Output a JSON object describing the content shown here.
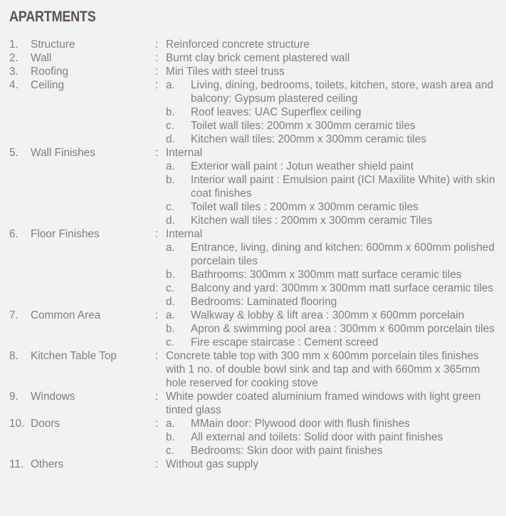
{
  "title": "APARTMENTS",
  "items": [
    {
      "num": "1.",
      "label": "Structure",
      "text": "Reinforced concrete structure",
      "subs": []
    },
    {
      "num": "2.",
      "label": "Wall",
      "text": "Burnt clay brick cement plastered wall",
      "subs": []
    },
    {
      "num": "3.",
      "label": "Roofing",
      "text": "Miri Tiles with steel truss",
      "subs": []
    },
    {
      "num": "4.",
      "label": "Ceiling",
      "text": "",
      "subs": [
        {
          "letter": "a.",
          "text": "Living, dining, bedrooms, toilets, kitchen, store, wash area and balcony: Gypsum plastered ceiling"
        },
        {
          "letter": "b.",
          "text": "Roof leaves: UAC Superflex ceiling"
        },
        {
          "letter": "c.",
          "text": "Toilet wall tiles: 200mm x 300mm ceramic tiles"
        },
        {
          "letter": "d.",
          "text": "Kitchen wall tiles: 200mm x 300mm ceramic tiles"
        }
      ]
    },
    {
      "num": "5.",
      "label": "Wall Finishes",
      "text": "Internal",
      "subs": [
        {
          "letter": "a.",
          "text": "Exterior wall paint : Jotun weather shield paint"
        },
        {
          "letter": "b.",
          "text": "Interior wall paint : Emulsion paint (ICI Maxilite White) with skin coat finishes"
        },
        {
          "letter": "c.",
          "text": "Toilet wall tiles : 200mm x 300mm ceramic tiles"
        },
        {
          "letter": "d.",
          "text": "Kitchen wall tiles : 200mm x 300mm ceramic Tiles"
        }
      ]
    },
    {
      "num": "6.",
      "label": "Floor Finishes",
      "text": "Internal",
      "subs": [
        {
          "letter": "a.",
          "text": "Entrance, living, dining and kitchen: 600mm x 600mm polished porcelain tiles"
        },
        {
          "letter": "b.",
          "text": "Bathrooms: 300mm x 300mm matt surface ceramic tiles"
        },
        {
          "letter": "c.",
          "text": "Balcony and yard: 300mm x 300mm matt surface ceramic tiles"
        },
        {
          "letter": "d.",
          "text": "Bedrooms: Laminated flooring"
        }
      ]
    },
    {
      "num": "7.",
      "label": "Common Area",
      "text": "",
      "subs": [
        {
          "letter": "a.",
          "text": "Walkway & lobby & lift area : 300mm x 600mm porcelain"
        },
        {
          "letter": "b.",
          "text": "Apron & swimming pool area : 300mm x 600mm porcelain tiles"
        },
        {
          "letter": "c.",
          "text": "Fire escape staircase : Cement screed"
        }
      ]
    },
    {
      "num": "8.",
      "label": "Kitchen Table Top",
      "text": "Concrete table top with 300 mm x 600mm porcelain tiles finishes with 1 no. of double bowl sink and tap and with 660mm x 365mm hole reserved for cooking stove",
      "subs": []
    },
    {
      "num": "9.",
      "label": "Windows",
      "text": "White powder coated aluminium framed windows with light green tinted glass",
      "subs": []
    },
    {
      "num": "10.",
      "label": "Doors",
      "text": "",
      "subs": [
        {
          "letter": "a.",
          "text": "MMain door: Plywood door with flush finishes"
        },
        {
          "letter": "b.",
          "text": "All external and toilets: Solid door with paint finishes"
        },
        {
          "letter": "c.",
          "text": "Bedrooms: Skin door with paint finishes"
        }
      ]
    },
    {
      "num": "11.",
      "label": "Others",
      "text": "Without gas supply",
      "subs": []
    }
  ],
  "separator": ":"
}
